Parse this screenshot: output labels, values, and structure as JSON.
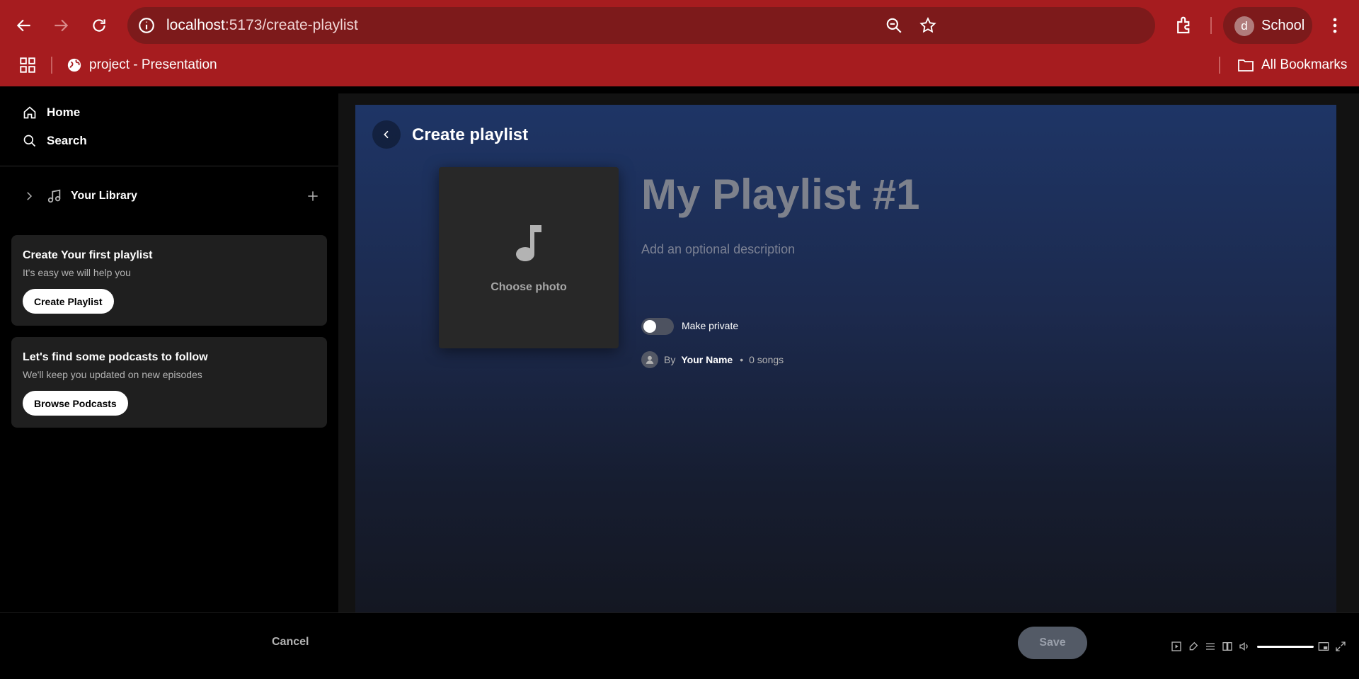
{
  "browser": {
    "url_host": "localhost",
    "url_path": ":5173/create-playlist",
    "bookmark": "project - Presentation",
    "all_bookmarks": "All Bookmarks",
    "profile_initial": "d",
    "profile_name": "School"
  },
  "sidebar": {
    "home": "Home",
    "search": "Search",
    "library": "Your Library",
    "cards": [
      {
        "title": "Create Your first playlist",
        "subtitle": "It's easy we will help you",
        "button": "Create Playlist"
      },
      {
        "title": "Let's find some podcasts to follow",
        "subtitle": "We'll keep you updated on new episodes",
        "button": "Browse Podcasts"
      }
    ]
  },
  "main": {
    "page_title": "Create playlist",
    "choose_photo": "Choose photo",
    "playlist_name": "My Playlist #1",
    "description_placeholder": "Add an optional description",
    "make_private": "Make private",
    "make_private_on": false,
    "by_label": "By",
    "owner_name": "Your Name",
    "separator": "•",
    "song_count": "0 songs"
  },
  "footer": {
    "cancel": "Cancel",
    "save": "Save"
  },
  "colors": {
    "browser_chrome": "#a61c1f",
    "omnibox": "#7d1a1b",
    "gradient_top": "#1e3566",
    "card_bg": "#1f1f1f"
  }
}
